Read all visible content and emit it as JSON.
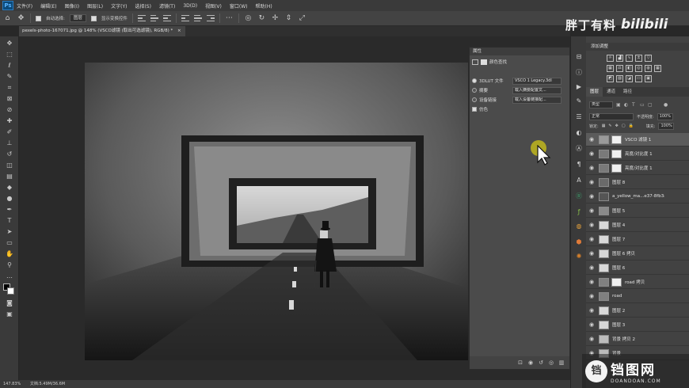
{
  "menubar": {
    "app_logo": "Ps",
    "items": [
      "文件(F)",
      "编辑(E)",
      "图像(I)",
      "图层(L)",
      "文字(Y)",
      "选择(S)",
      "滤镜(T)",
      "3D(D)",
      "视图(V)",
      "窗口(W)",
      "帮助(H)"
    ]
  },
  "options": {
    "auto_select_label": "自动选择:",
    "auto_select_target": "图层",
    "show_transform_label": "显示变换控件"
  },
  "document": {
    "tab_title": "pexels-photo-167071.jpg @ 148% (VSCO滤镜 (取出可选滤镜), RGB/8) *",
    "close_glyph": "×"
  },
  "status": {
    "zoom": "147.83%",
    "doc_info": "文档:5.49M/36.6M"
  },
  "brand": {
    "cn_text": "胖丁有料",
    "bili_text": "bilibili"
  },
  "properties": {
    "title": "属性",
    "subheader": "颜色查找",
    "rows": [
      {
        "label": "3DLUT 文件",
        "value": "VSCO 1 Legacy.3dl",
        "checked": true
      },
      {
        "label": "摘要",
        "value": "载入摘要配置文...",
        "checked": false
      },
      {
        "label": "设备链接",
        "value": "载入设备链接配...",
        "checked": false
      },
      {
        "label": "仿色",
        "value": "",
        "checked": true
      }
    ]
  },
  "adjustments": {
    "title": "添加调整"
  },
  "layers_panel": {
    "tabs": [
      "图层",
      "通道",
      "路径"
    ],
    "kind_filter": "类型",
    "blend_mode": "正常",
    "opacity_label": "不透明度:",
    "opacity_value": "100%",
    "lock_label": "锁定:",
    "fill_label": "填充:",
    "fill_value": "100%",
    "layers": [
      {
        "name": "VSCO 滤镜 1",
        "selected": true,
        "mask": true,
        "thumb": "#9a9a9a"
      },
      {
        "name": "亮度/对比度 1",
        "selected": false,
        "mask": true,
        "thumb": "#7a7a7a"
      },
      {
        "name": "亮度/对比度 1",
        "selected": false,
        "mask": true,
        "thumb": "#7a7a7a"
      },
      {
        "name": "图层 8",
        "selected": false,
        "mask": false,
        "thumb": "#6a6a6a"
      },
      {
        "name": "a_yellow_ma...e37-8fb3aa4",
        "selected": false,
        "mask": false,
        "thumb": "#555"
      },
      {
        "name": "图层 5",
        "selected": false,
        "mask": false,
        "thumb": "#8a8a8a"
      },
      {
        "name": "图层 4",
        "selected": false,
        "mask": false,
        "thumb": "#d8d8d8"
      },
      {
        "name": "图层 7",
        "selected": false,
        "mask": false,
        "thumb": "#d8d8d8"
      },
      {
        "name": "图层 6 拷贝",
        "selected": false,
        "mask": false,
        "thumb": "#d8d8d8"
      },
      {
        "name": "图层 6",
        "selected": false,
        "mask": false,
        "thumb": "#d8d8d8"
      },
      {
        "name": "road 拷贝",
        "selected": false,
        "mask": true,
        "thumb": "#808080"
      },
      {
        "name": "road",
        "selected": false,
        "mask": false,
        "thumb": "#808080"
      },
      {
        "name": "图层 2",
        "selected": false,
        "mask": false,
        "thumb": "#d8d8d8"
      },
      {
        "name": "图层 3",
        "selected": false,
        "mask": false,
        "thumb": "#d8d8d8"
      },
      {
        "name": "背景 拷贝 2",
        "selected": false,
        "mask": false,
        "thumb": "#bcbcbc"
      },
      {
        "name": "背景",
        "selected": false,
        "mask": false,
        "thumb": "#bcbcbc"
      }
    ]
  },
  "watermark": {
    "cn_text": "铛图网",
    "en_text": "DOANDOAN.COM",
    "logo_glyph": "铛"
  },
  "colors": {
    "accent_highlight": "#b9b020",
    "ps_blue": "#2c7cc0"
  }
}
